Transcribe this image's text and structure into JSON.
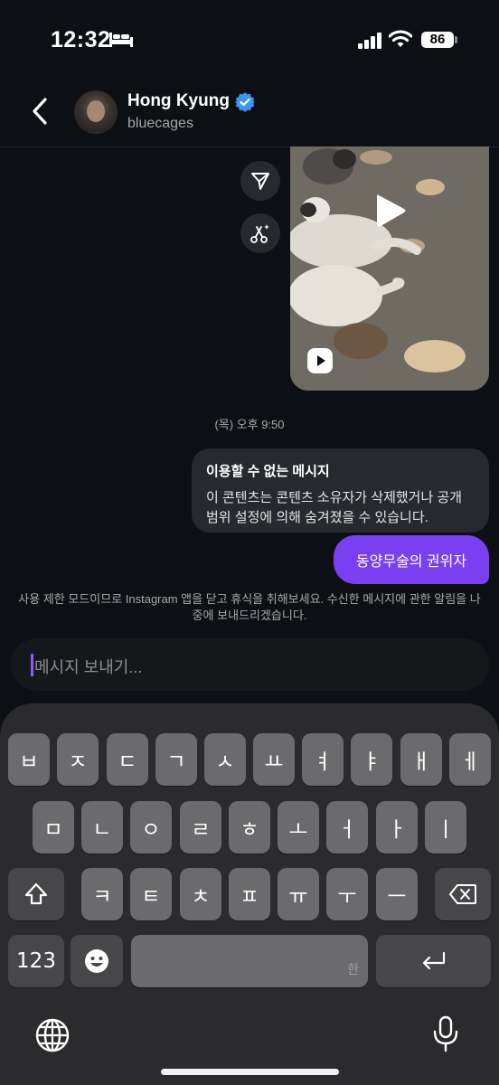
{
  "status_bar": {
    "time": "12:32",
    "battery": "86"
  },
  "header": {
    "name": "Hong Kyung",
    "username": "bluecages"
  },
  "conversation": {
    "timestamp": "(목) 오후 9:50",
    "unavailable_title": "이용할 수 없는 메시지",
    "unavailable_body": "이 콘텐츠는 콘텐츠 소유자가 삭제했거나 공개 범위 설정에 의해 숨겨졌을 수 있습니다.",
    "sent_message": "동양무술의 권위자",
    "notice": "사용 제한 모드이므로 Instagram 앱을 닫고 휴식을 취해보세요. 수신한 메시지에 관한 알림을 나중에 보내드리겠습니다."
  },
  "composer": {
    "placeholder": "메시지 보내기..."
  },
  "keyboard": {
    "row1": [
      "ㅂ",
      "ㅈ",
      "ㄷ",
      "ㄱ",
      "ㅅ",
      "ㅛ",
      "ㅕ",
      "ㅑ",
      "ㅐ",
      "ㅔ"
    ],
    "row2": [
      "ㅁ",
      "ㄴ",
      "ㅇ",
      "ㄹ",
      "ㅎ",
      "ㅗ",
      "ㅓ",
      "ㅏ",
      "ㅣ"
    ],
    "row3": [
      "ㅋ",
      "ㅌ",
      "ㅊ",
      "ㅍ",
      "ㅠ",
      "ㅜ",
      "ㅡ"
    ],
    "numbers_key": "123",
    "space_sub": "한"
  },
  "colors": {
    "accent": "#7b3ff2",
    "verified": "#3b97f3",
    "background": "#0c1014"
  },
  "icons": [
    "bed-icon",
    "signal-icon",
    "wifi-icon",
    "back-icon",
    "verified-icon",
    "share-icon",
    "remix-icon",
    "play-icon",
    "reel-icon",
    "shift-icon",
    "backspace-icon",
    "emoji-icon",
    "return-icon",
    "globe-icon",
    "mic-icon"
  ]
}
